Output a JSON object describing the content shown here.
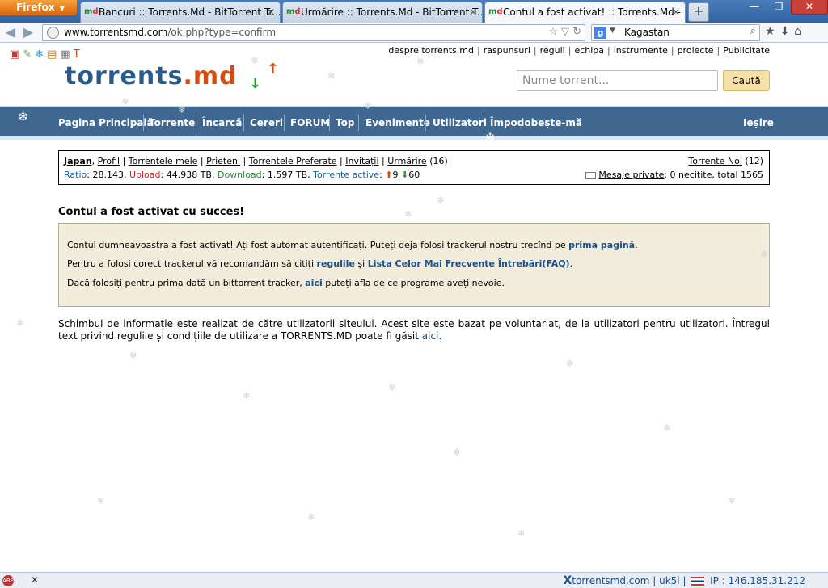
{
  "browser": {
    "menu_button": "Firefox",
    "tabs": [
      {
        "label": "Bancuri :: Torrents.Md - BitTorrent Tr...",
        "active": false
      },
      {
        "label": "Urmărire :: Torrents.Md - BitTorrent T...",
        "active": false
      },
      {
        "label": "Contul a fost activat! :: Torrents.Md - ...",
        "active": true
      }
    ],
    "url_domain": "www.torrentsmd.com",
    "url_path": "/ok.php?type=confirm",
    "search_query": "Kagastan"
  },
  "site": {
    "top_links": [
      "despre torrents.md",
      "raspunsuri",
      "reguli",
      "echipa",
      "instrumente",
      "proiecte",
      "Publicitate"
    ],
    "logo_text": "torrents",
    "logo_suffix": ".md",
    "search_placeholder": "Nume torrent...",
    "search_button": "Caută",
    "nav": [
      "Pagina Principală",
      "Torrente",
      "Încarcă",
      "Cereri",
      "FORUM",
      "Top",
      "Evenimente",
      "Utilizatori",
      "Împodobește-mă"
    ],
    "logout": "Ieșire"
  },
  "userbox": {
    "username": "Japan",
    "links": [
      "Profil",
      "Torrentele mele",
      "Prieteni",
      "Torrentele Preferate",
      "Invitații",
      "Urmărire"
    ],
    "watch_count": "(16)",
    "ratio_label": "Ratio",
    "ratio_value": "28.143",
    "upload_label": "Upload",
    "upload_value": "44.938 TB",
    "download_label": "Download",
    "download_value": "1.597 TB",
    "active_label": "Torrente active",
    "active_up": "9",
    "active_down": "60",
    "new_torrents_label": "Torrente Noi",
    "new_torrents_count": "(12)",
    "pm_label": "Mesaje private",
    "pm_status": ": 0 necitite, total 1565"
  },
  "content": {
    "heading": "Contul a fost activat cu succes!",
    "p1_text": "Contul dumneavoastra a fost activat! Ați fost automat autentificați. Puteți deja folosi trackerul nostru trecînd pe ",
    "p1_link": "prima pagină",
    "p1_end": ".",
    "p2_text": "Pentru a folosi corect trackerul vă recomandăm să citiți ",
    "p2_link1": "regulile",
    "p2_mid": " și ",
    "p2_link2": "Lista Celor Mai Frecvente Întrebări(FAQ)",
    "p2_end": ".",
    "p3_text": "Dacă folosiți pentru prima dată un bittorrent tracker, ",
    "p3_link": "aici",
    "p3_end": " puteți afla de ce programe aveți nevoie.",
    "footer_text": "Schimbul de informație este realizat de către utilizatorii siteului. Acest site este bazat pe voluntariat, de la utilizatori pentru utilizatori. Întregul text privind regulile și condițiile de utilizare a TORRENTS.MD poate fi găsit ",
    "footer_link": "aici",
    "footer_end": "."
  },
  "statusbar": {
    "text": "torrentsmd.com | uk5i",
    "ip": "IP : 146.185.31.212"
  }
}
